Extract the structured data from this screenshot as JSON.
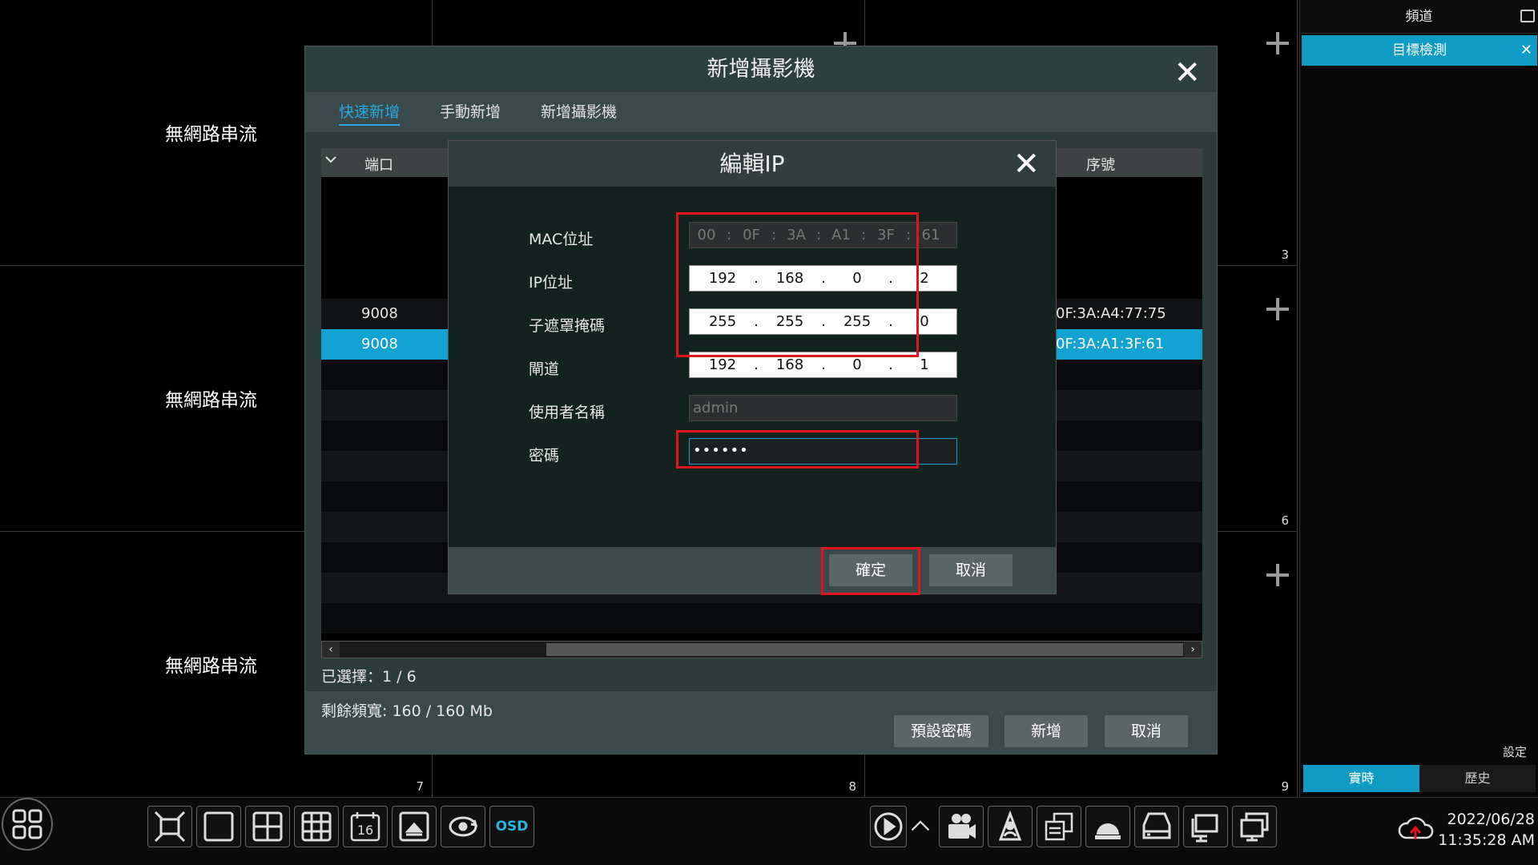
{
  "grid": {
    "no_stream_label": "無網路串流",
    "cells": [
      {
        "num": "",
        "label": "",
        "plus": false
      },
      {
        "num": "",
        "label": "",
        "plus": false
      },
      {
        "num": "3",
        "label": "",
        "plus": true
      },
      {
        "num": "",
        "label": "無網路串流",
        "plus": false
      },
      {
        "num": "",
        "label": "",
        "plus": false
      },
      {
        "num": "6",
        "label": "",
        "plus": true
      },
      {
        "num": "7",
        "label": "無網路串流",
        "plus": false
      },
      {
        "num": "8",
        "label": "",
        "plus": false
      },
      {
        "num": "9",
        "label": "",
        "plus": true
      }
    ]
  },
  "right_panel": {
    "header": "頻道",
    "active_tab": "目標檢測",
    "settings_label": "設定",
    "mode_realtime": "實時",
    "mode_history": "歷史"
  },
  "toolbar": {
    "osd_label": "OSD",
    "grid16_label": "16",
    "date": "2022/06/28",
    "time": "11:35:28 AM"
  },
  "add_camera_dialog": {
    "title": "新增攝影機",
    "tabs": [
      "快速新增",
      "手動新增",
      "新增攝影機"
    ],
    "active_tab_index": 0,
    "columns": {
      "port": "端口",
      "serial": "序號"
    },
    "rows": [
      {
        "port": "9008",
        "mac_tail": "0F:3A:A4:77:75",
        "selected": false
      },
      {
        "port": "9008",
        "mac_tail": "0F:3A:A1:3F:61",
        "selected": true
      }
    ],
    "selected_count": "已選擇：1 / 6",
    "bandwidth": "剩餘頻寬: 160 / 160 Mb",
    "btn_default_password": "預設密碼",
    "btn_add": "新增",
    "btn_cancel": "取消"
  },
  "edit_ip_modal": {
    "title": "編輯IP",
    "mac_label": "MAC位址",
    "mac_segments": [
      "00",
      "0F",
      "3A",
      "A1",
      "3F",
      "61"
    ],
    "mac_separator": ":",
    "ip_label": "IP位址",
    "ip_segments": [
      "192",
      "168",
      "0",
      "2"
    ],
    "mask_label": "子遮罩掩碼",
    "mask_segments": [
      "255",
      "255",
      "255",
      "0"
    ],
    "gateway_label": "閘道",
    "gateway_segments": [
      "192",
      "168",
      "0",
      "1"
    ],
    "ip_separator": ".",
    "username_label": "使用者名稱",
    "username_value": "admin",
    "password_label": "密碼",
    "password_value": "••••••",
    "btn_ok": "確定",
    "btn_cancel": "取消"
  },
  "colors": {
    "accent_blue": "#12a3d2",
    "highlight_red": "#e0141c",
    "dialog_bg": "#2b3c3b"
  }
}
